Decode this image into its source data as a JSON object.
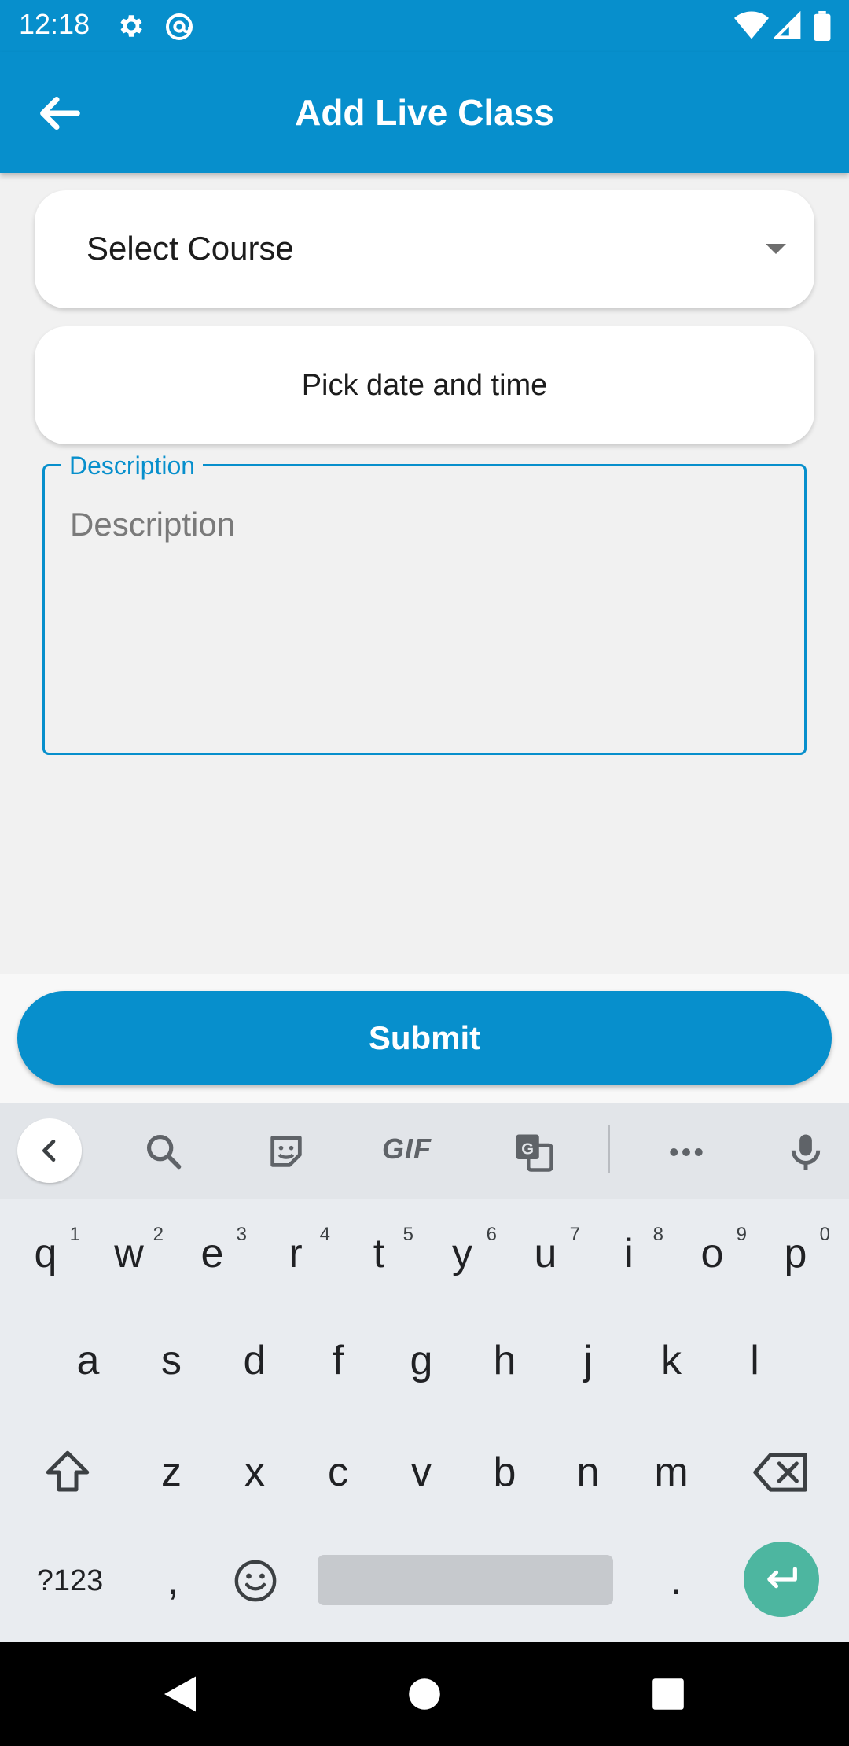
{
  "status_bar": {
    "time": "12:18",
    "icons": [
      "gear-icon",
      "at-sign-icon",
      "wifi-icon",
      "signal-icon",
      "battery-icon"
    ]
  },
  "app_bar": {
    "title": "Add Live Class",
    "back_icon": "arrow-left-icon",
    "background": "#078fcc"
  },
  "form": {
    "course_select": {
      "label": "Select Course",
      "icon": "dropdown-arrow-icon"
    },
    "date_time": {
      "label": "Pick date and time"
    },
    "description": {
      "floating_label": "Description",
      "placeholder": "Description",
      "value": ""
    },
    "submit_label": "Submit"
  },
  "keyboard": {
    "toolbar_icons": [
      "chevron-left-icon",
      "search-icon",
      "sticker-icon",
      "gif-icon",
      "translate-icon",
      "more-icon",
      "mic-icon"
    ],
    "gif_label": "GIF",
    "row1": [
      {
        "key": "q",
        "hint": "1"
      },
      {
        "key": "w",
        "hint": "2"
      },
      {
        "key": "e",
        "hint": "3"
      },
      {
        "key": "r",
        "hint": "4"
      },
      {
        "key": "t",
        "hint": "5"
      },
      {
        "key": "y",
        "hint": "6"
      },
      {
        "key": "u",
        "hint": "7"
      },
      {
        "key": "i",
        "hint": "8"
      },
      {
        "key": "o",
        "hint": "9"
      },
      {
        "key": "p",
        "hint": "0"
      }
    ],
    "row2": [
      "a",
      "s",
      "d",
      "f",
      "g",
      "h",
      "j",
      "k",
      "l"
    ],
    "row3": [
      "z",
      "x",
      "c",
      "v",
      "b",
      "n",
      "m"
    ],
    "symbols_label": "?123",
    "comma": ",",
    "period": ".",
    "accent_color": "#4db6a0"
  },
  "nav_bar": {
    "icons": [
      "back-triangle-icon",
      "home-circle-icon",
      "recents-square-icon"
    ]
  }
}
